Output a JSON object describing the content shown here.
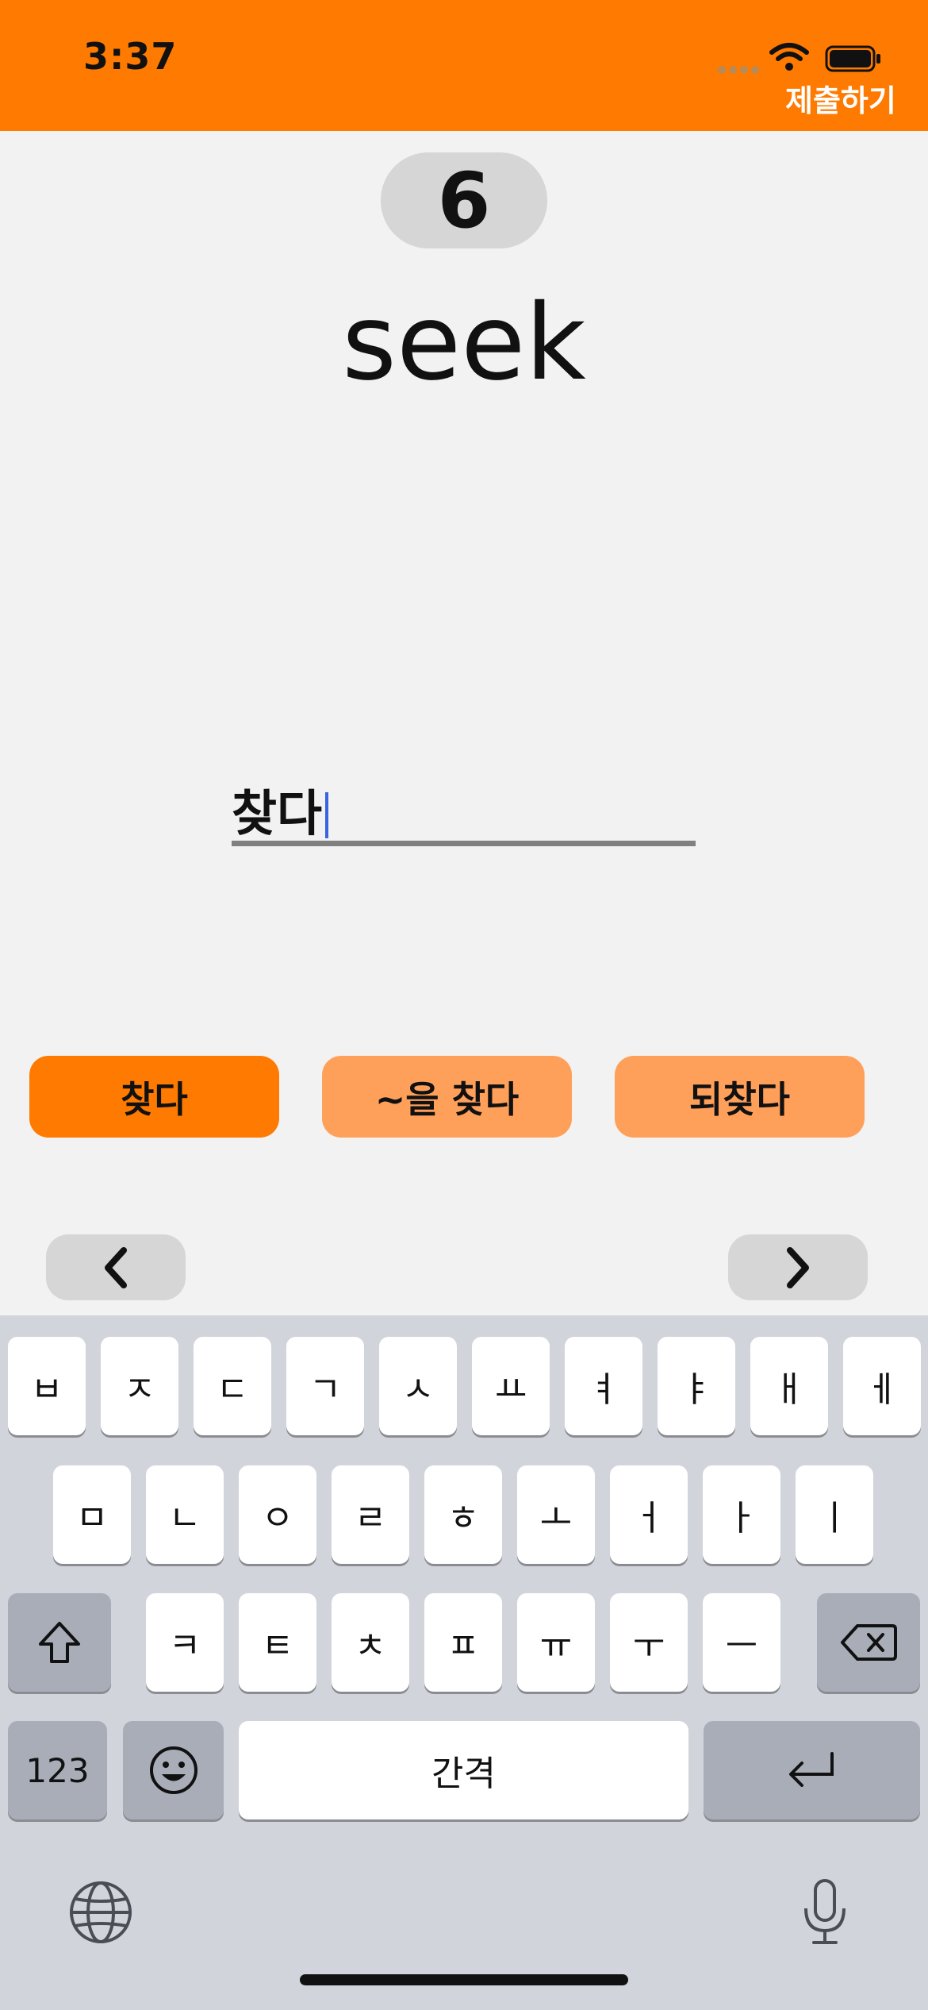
{
  "status": {
    "time": "3:37"
  },
  "header": {
    "submit_label": "제출하기"
  },
  "question": {
    "number": "6",
    "word": "seek"
  },
  "answer": {
    "value": "찾다"
  },
  "choices": [
    "찾다",
    "~을 찾다",
    "되찾다"
  ],
  "keyboard": {
    "row1": [
      "ㅂ",
      "ㅈ",
      "ㄷ",
      "ㄱ",
      "ㅅ",
      "ㅛ",
      "ㅕ",
      "ㅑ",
      "ㅐ",
      "ㅔ"
    ],
    "row2": [
      "ㅁ",
      "ㄴ",
      "ㅇ",
      "ㄹ",
      "ㅎ",
      "ㅗ",
      "ㅓ",
      "ㅏ",
      "ㅣ"
    ],
    "row3": [
      "ㅋ",
      "ㅌ",
      "ㅊ",
      "ㅍ",
      "ㅠ",
      "ㅜ",
      "ㅡ"
    ],
    "numbers_label": "123",
    "space_label": "간격"
  },
  "colors": {
    "accent": "#ff7a00",
    "accent_light": "#ffa05a"
  }
}
